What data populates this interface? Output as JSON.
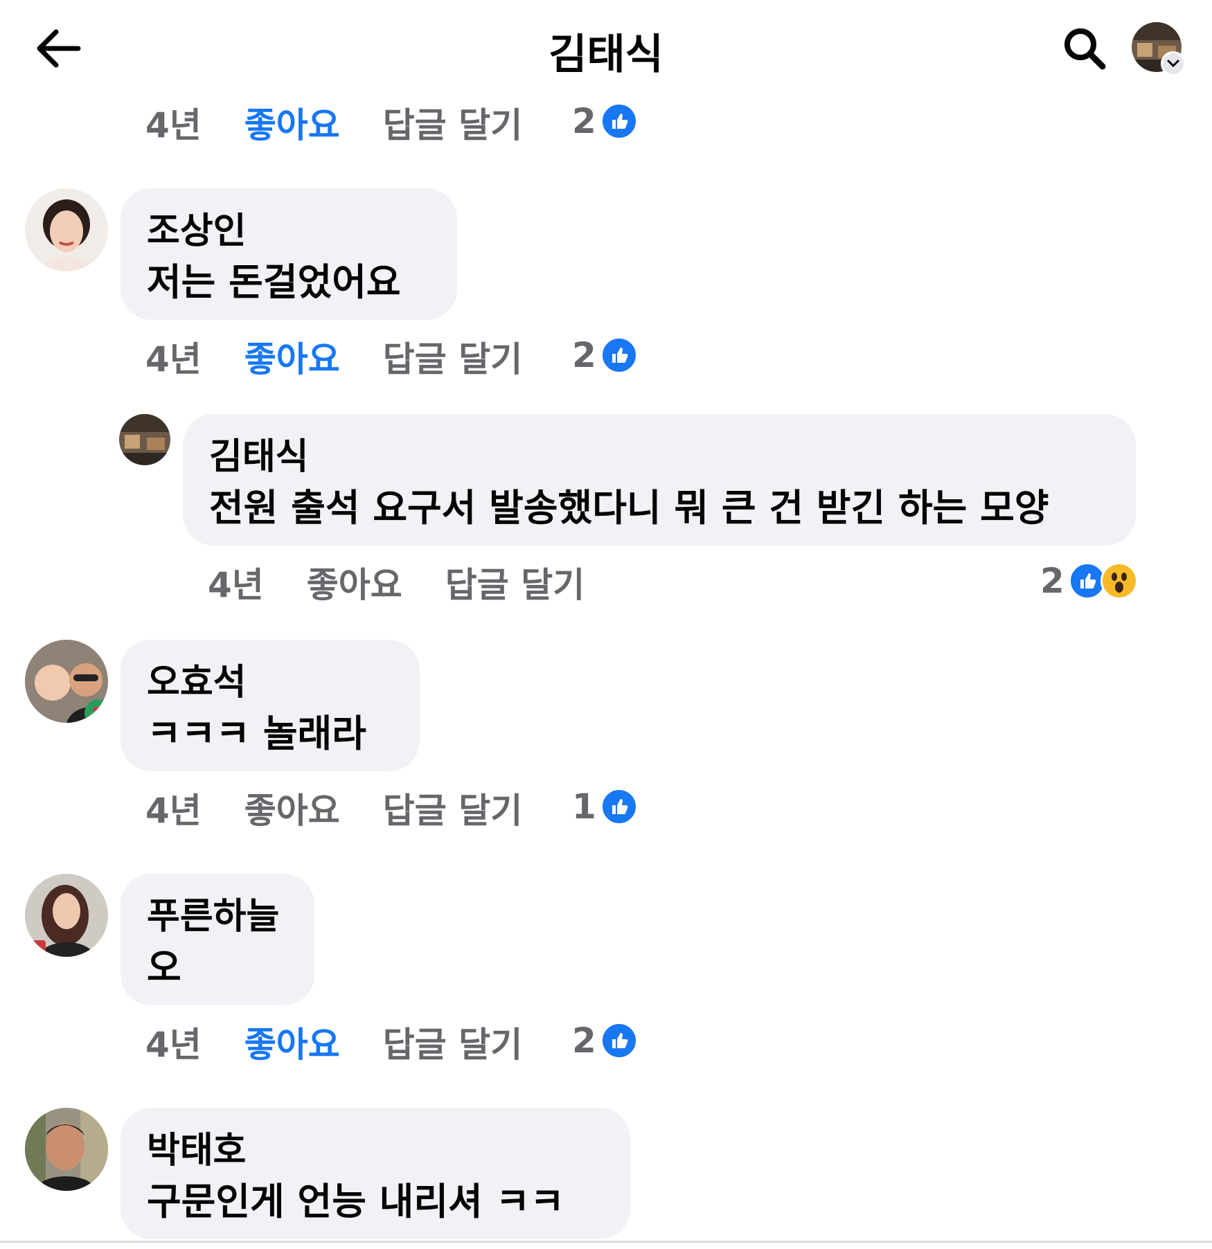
{
  "header": {
    "title": "김태식"
  },
  "comments": [
    {
      "time": "4년",
      "like_label": "좋아요",
      "reply_label": "답글 달기",
      "reaction_count": "2",
      "liked": true
    },
    {
      "author": "조상인",
      "text": "저는 돈걸었어요",
      "time": "4년",
      "like_label": "좋아요",
      "reply_label": "답글 달기",
      "reaction_count": "2",
      "liked": true
    },
    {
      "author": "김태식",
      "text": "전원 출석 요구서 발송했다니 뭐 큰 건 받긴 하는 모양",
      "time": "4년",
      "like_label": "좋아요",
      "reply_label": "답글 달기",
      "reaction_count": "2",
      "liked": false
    },
    {
      "author": "오효석",
      "text": "ㅋㅋㅋ 놀래라",
      "time": "4년",
      "like_label": "좋아요",
      "reply_label": "답글 달기",
      "reaction_count": "1",
      "liked": false
    },
    {
      "author": "푸른하늘",
      "text": "오",
      "time": "4년",
      "like_label": "좋아요",
      "reply_label": "답글 달기",
      "reaction_count": "2",
      "liked": true
    },
    {
      "author": "박태호",
      "text": "구문인게 언능 내리셔 ㅋㅋ"
    }
  ],
  "colors": {
    "like_blue": "#1877f2",
    "bubble_bg": "#f0f2f5",
    "meta_gray": "#65676b",
    "wow_yellow": "#f7b928"
  },
  "icons": [
    "back-arrow-icon",
    "search-icon",
    "chevron-down-icon",
    "like-reaction-icon",
    "wow-reaction-icon"
  ]
}
